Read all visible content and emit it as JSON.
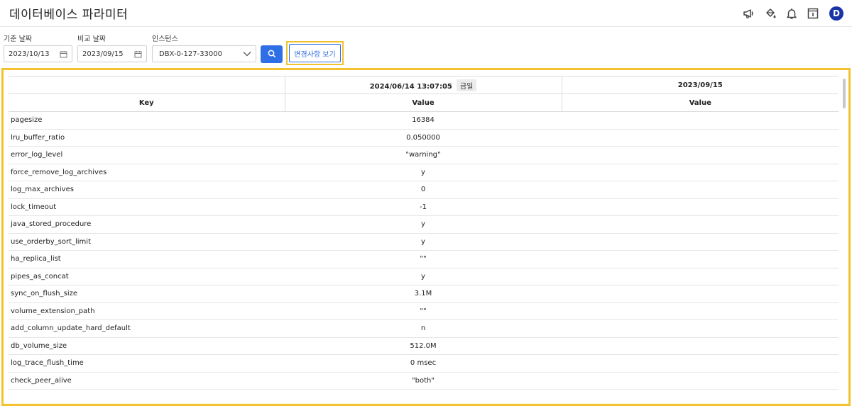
{
  "header": {
    "title": "데이터베이스 파라미터",
    "icons": [
      "megaphone-icon",
      "paint-bucket-icon",
      "bell-icon",
      "info-window-icon"
    ],
    "avatar_initial": "D"
  },
  "filters": {
    "base_date_label": "기준 날짜",
    "base_date_value": "2023/10/13",
    "compare_date_label": "비교 날짜",
    "compare_date_value": "2023/09/15",
    "instance_label": "인스턴스",
    "instance_value": "DBX-0-127-33000",
    "view_changes_label": "변경사항 보기"
  },
  "table": {
    "col_current_date": "2024/06/14 13:07:05",
    "today_badge": "금일",
    "col_compare_date": "2023/09/15",
    "key_header": "Key",
    "value_header": "Value",
    "rows": [
      {
        "key": "pagesize",
        "current": "16384",
        "compare": ""
      },
      {
        "key": "lru_buffer_ratio",
        "current": "0.050000",
        "compare": ""
      },
      {
        "key": "error_log_level",
        "current": "\"warning\"",
        "compare": ""
      },
      {
        "key": "force_remove_log_archives",
        "current": "y",
        "compare": ""
      },
      {
        "key": "log_max_archives",
        "current": "0",
        "compare": ""
      },
      {
        "key": "lock_timeout",
        "current": "-1",
        "compare": ""
      },
      {
        "key": "java_stored_procedure",
        "current": "y",
        "compare": ""
      },
      {
        "key": "use_orderby_sort_limit",
        "current": "y",
        "compare": ""
      },
      {
        "key": "ha_replica_list",
        "current": "\"\"",
        "compare": ""
      },
      {
        "key": "pipes_as_concat",
        "current": "y",
        "compare": ""
      },
      {
        "key": "sync_on_flush_size",
        "current": "3.1M",
        "compare": ""
      },
      {
        "key": "volume_extension_path",
        "current": "\"\"",
        "compare": ""
      },
      {
        "key": "add_column_update_hard_default",
        "current": "n",
        "compare": ""
      },
      {
        "key": "db_volume_size",
        "current": "512.0M",
        "compare": ""
      },
      {
        "key": "log_trace_flush_time",
        "current": "0 msec",
        "compare": ""
      },
      {
        "key": "check_peer_alive",
        "current": "\"both\"",
        "compare": ""
      }
    ]
  },
  "colors": {
    "accent": "#2f6fe6",
    "highlight": "#f2c230",
    "avatar": "#1a34a8"
  }
}
